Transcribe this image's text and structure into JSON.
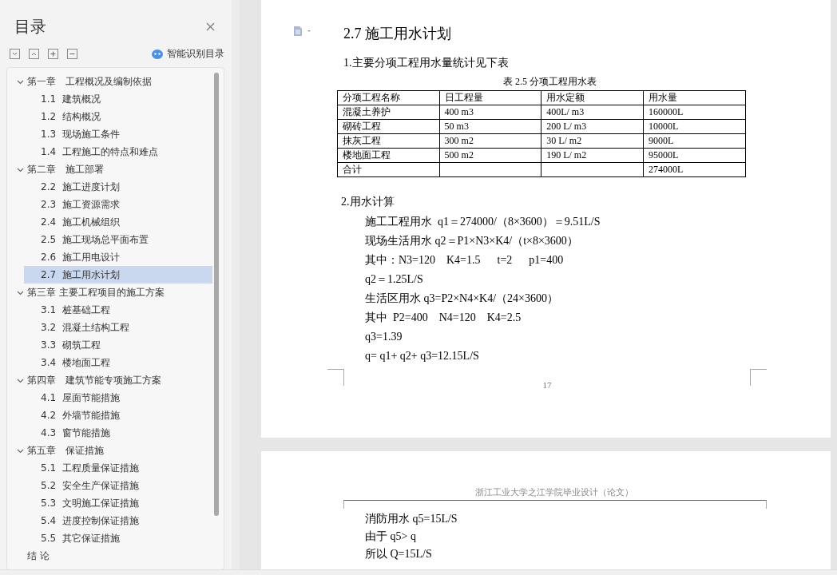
{
  "sidebar": {
    "title": "目录",
    "smart_button": "智能识别目录",
    "toc": [
      {
        "label": "第一章　工程概况及编制依据",
        "expanded": true,
        "selected": false,
        "children": [
          {
            "label": "1.1  建筑概况",
            "selected": false
          },
          {
            "label": "1.2  结构概况",
            "selected": false
          },
          {
            "label": "1.3  现场施工条件",
            "selected": false
          },
          {
            "label": "1.4  工程施工的特点和难点",
            "selected": false
          }
        ]
      },
      {
        "label": "第二章　施工部署",
        "expanded": true,
        "selected": false,
        "children": [
          {
            "label": "2.2  施工进度计划",
            "selected": false
          },
          {
            "label": "2.3  施工资源需求",
            "selected": false
          },
          {
            "label": "2.4  施工机械组织",
            "selected": false
          },
          {
            "label": "2.5  施工现场总平面布置",
            "selected": false
          },
          {
            "label": "2.6  施工用电设计",
            "selected": false
          },
          {
            "label": "2.7  施工用水计划",
            "selected": true
          }
        ]
      },
      {
        "label": "第三章 主要工程项目的施工方案",
        "expanded": true,
        "selected": false,
        "children": [
          {
            "label": "3.1  桩基础工程",
            "selected": false
          },
          {
            "label": "3.2  混凝土结构工程",
            "selected": false
          },
          {
            "label": "3.3  砌筑工程",
            "selected": false
          },
          {
            "label": "3.4  楼地面工程",
            "selected": false
          }
        ]
      },
      {
        "label": "第四章　建筑节能专项施工方案",
        "expanded": true,
        "selected": false,
        "children": [
          {
            "label": "4.1  屋面节能措施",
            "selected": false
          },
          {
            "label": "4.2  外墙节能措施",
            "selected": false
          },
          {
            "label": "4.3  窗节能措施",
            "selected": false
          }
        ]
      },
      {
        "label": "第五章　保证措施",
        "expanded": true,
        "selected": false,
        "children": [
          {
            "label": "5.1  工程质量保证措施",
            "selected": false
          },
          {
            "label": "5.2  安全生产保证措施",
            "selected": false
          },
          {
            "label": "5.3  文明施工保证措施",
            "selected": false
          },
          {
            "label": "5.4  进度控制保证措施",
            "selected": false
          },
          {
            "label": "5.5  其它保证措施",
            "selected": false
          }
        ]
      },
      {
        "label": "结 论",
        "selected": false
      }
    ]
  },
  "document": {
    "pages": [
      {
        "heading": "2.7  施工用水计划",
        "intro": "1.主要分项工程用水量统计见下表",
        "table": {
          "caption": "表 2.5  分项工程用水表",
          "columns": [
            "分项工程名称",
            "日工程量",
            "用水定额",
            "用水量"
          ],
          "rows": [
            [
              "混凝土养护",
              "400 m3",
              "400L/ m3",
              "160000L"
            ],
            [
              "砌砖工程",
              "50 m3",
              "200 L/ m3",
              "10000L"
            ],
            [
              "抹灰工程",
              "300 m2",
              "30 L/ m2",
              "9000L"
            ],
            [
              "楼地面工程",
              "500 m2",
              "190 L/ m2",
              "95000L"
            ],
            [
              "合计",
              "",
              "",
              "274000L"
            ]
          ]
        },
        "section": "2.用水计算",
        "lines": [
          "施工工程用水  q1＝274000/（8×3600）＝9.51L/S",
          "现场生活用水 q2＝P1×N3×K4/（t×8×3600）",
          "其中：N3=120    K4=1.5      t=2      p1=400",
          "q2＝1.25L/S",
          "生活区用水 q3=P2×N4×K4/（24×3600）",
          "其中  P2=400    N4=120    K4=2.5",
          "q3=1.39",
          "q= q1+ q2+ q3=12.15L/S"
        ],
        "page_number": "17"
      },
      {
        "header": "浙江工业大学之江学院毕业设计（论文）",
        "lines": [
          "消防用水 q5=15L/S",
          "由于 q5> q",
          "所以 Q=15L/S"
        ]
      }
    ]
  }
}
